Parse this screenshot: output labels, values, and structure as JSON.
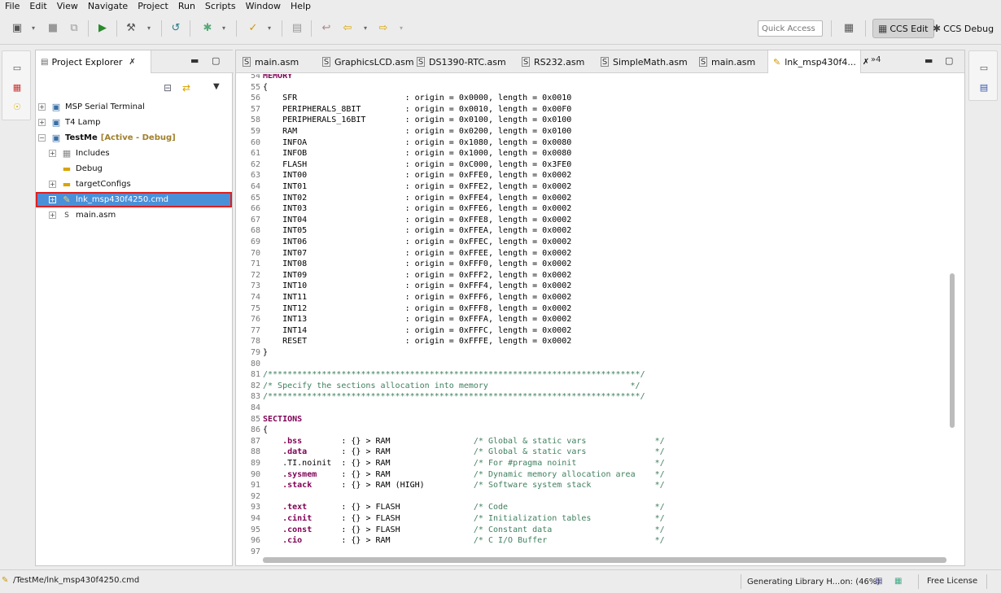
{
  "menu": [
    "File",
    "Edit",
    "View",
    "Navigate",
    "Project",
    "Run",
    "Scripts",
    "Window",
    "Help"
  ],
  "toolbar": {
    "quick_access_placeholder": "Quick Access",
    "perspectives": [
      {
        "label": "CCS Edit",
        "active": true
      },
      {
        "label": "CCS Debug",
        "active": false
      }
    ]
  },
  "explorer": {
    "title": "Project Explorer",
    "items": [
      {
        "label": "MSP Serial Terminal",
        "decoration": ""
      },
      {
        "label": "T4 Lamp",
        "decoration": ""
      },
      {
        "label": "TestMe",
        "decoration": "[Active - Debug]"
      },
      {
        "label": "Includes",
        "decoration": ""
      },
      {
        "label": "Debug",
        "decoration": ""
      },
      {
        "label": "targetConfigs",
        "decoration": ""
      },
      {
        "label": "lnk_msp430f4250.cmd",
        "decoration": ""
      },
      {
        "label": "main.asm",
        "decoration": ""
      }
    ],
    "selected": "lnk_msp430f4250.cmd"
  },
  "editor": {
    "tabs": [
      "main.asm",
      "GraphicsLCD.asm",
      "DS1390-RTC.asm",
      "RS232.asm",
      "SimpleMath.asm",
      "main.asm",
      "lnk_msp430f4..."
    ],
    "overflow": "»4",
    "lines": [
      {
        "n": "54",
        "t": "MEMORY",
        "k": "kw"
      },
      {
        "n": "55",
        "t": "{",
        "k": ""
      },
      {
        "n": "56",
        "t": "    SFR                      : origin = 0x0000, length = 0x0010",
        "k": ""
      },
      {
        "n": "57",
        "t": "    PERIPHERALS_8BIT         : origin = 0x0010, length = 0x00F0",
        "k": ""
      },
      {
        "n": "58",
        "t": "    PERIPHERALS_16BIT        : origin = 0x0100, length = 0x0100",
        "k": ""
      },
      {
        "n": "59",
        "t": "    RAM                      : origin = 0x0200, length = 0x0100",
        "k": ""
      },
      {
        "n": "60",
        "t": "    INFOA                    : origin = 0x1080, length = 0x0080",
        "k": ""
      },
      {
        "n": "61",
        "t": "    INFOB                    : origin = 0x1000, length = 0x0080",
        "k": ""
      },
      {
        "n": "62",
        "t": "    FLASH                    : origin = 0xC000, length = 0x3FE0",
        "k": ""
      },
      {
        "n": "63",
        "t": "    INT00                    : origin = 0xFFE0, length = 0x0002",
        "k": ""
      },
      {
        "n": "64",
        "t": "    INT01                    : origin = 0xFFE2, length = 0x0002",
        "k": ""
      },
      {
        "n": "65",
        "t": "    INT02                    : origin = 0xFFE4, length = 0x0002",
        "k": ""
      },
      {
        "n": "66",
        "t": "    INT03                    : origin = 0xFFE6, length = 0x0002",
        "k": ""
      },
      {
        "n": "67",
        "t": "    INT04                    : origin = 0xFFE8, length = 0x0002",
        "k": ""
      },
      {
        "n": "68",
        "t": "    INT05                    : origin = 0xFFEA, length = 0x0002",
        "k": ""
      },
      {
        "n": "69",
        "t": "    INT06                    : origin = 0xFFEC, length = 0x0002",
        "k": ""
      },
      {
        "n": "70",
        "t": "    INT07                    : origin = 0xFFEE, length = 0x0002",
        "k": ""
      },
      {
        "n": "71",
        "t": "    INT08                    : origin = 0xFFF0, length = 0x0002",
        "k": ""
      },
      {
        "n": "72",
        "t": "    INT09                    : origin = 0xFFF2, length = 0x0002",
        "k": ""
      },
      {
        "n": "73",
        "t": "    INT10                    : origin = 0xFFF4, length = 0x0002",
        "k": ""
      },
      {
        "n": "74",
        "t": "    INT11                    : origin = 0xFFF6, length = 0x0002",
        "k": ""
      },
      {
        "n": "75",
        "t": "    INT12                    : origin = 0xFFF8, length = 0x0002",
        "k": ""
      },
      {
        "n": "76",
        "t": "    INT13                    : origin = 0xFFFA, length = 0x0002",
        "k": ""
      },
      {
        "n": "77",
        "t": "    INT14                    : origin = 0xFFFC, length = 0x0002",
        "k": ""
      },
      {
        "n": "78",
        "t": "    RESET                    : origin = 0xFFFE, length = 0x0002",
        "k": ""
      },
      {
        "n": "79",
        "t": "}",
        "k": ""
      },
      {
        "n": "80",
        "t": "",
        "k": ""
      },
      {
        "n": "81",
        "t": "/****************************************************************************/",
        "k": "cm"
      },
      {
        "n": "82",
        "t": "/* Specify the sections allocation into memory                             */",
        "k": "cm"
      },
      {
        "n": "83",
        "t": "/****************************************************************************/",
        "k": "cm"
      },
      {
        "n": "84",
        "t": "",
        "k": ""
      },
      {
        "n": "85",
        "t": "SECTIONS",
        "k": "kw"
      },
      {
        "n": "86",
        "t": "{",
        "k": ""
      },
      {
        "n": "87",
        "t": "    .bss        : {} > RAM                 /* Global & static vars              */",
        "k": "sec",
        "kwpart": ".bss"
      },
      {
        "n": "88",
        "t": "    .data       : {} > RAM                 /* Global & static vars              */",
        "k": "sec",
        "kwpart": ".data"
      },
      {
        "n": "89",
        "t": "    .TI.noinit  : {} > RAM                 /* For #pragma noinit                */",
        "k": "sec",
        "kwpart": ""
      },
      {
        "n": "90",
        "t": "    .sysmem     : {} > RAM                 /* Dynamic memory allocation area    */",
        "k": "sec",
        "kwpart": ".sysmem"
      },
      {
        "n": "91",
        "t": "    .stack      : {} > RAM (HIGH)          /* Software system stack             */",
        "k": "sec",
        "kwpart": ".stack"
      },
      {
        "n": "92",
        "t": "",
        "k": ""
      },
      {
        "n": "93",
        "t": "    .text       : {} > FLASH               /* Code                              */",
        "k": "sec",
        "kwpart": ".text"
      },
      {
        "n": "94",
        "t": "    .cinit      : {} > FLASH               /* Initialization tables             */",
        "k": "sec",
        "kwpart": ".cinit"
      },
      {
        "n": "95",
        "t": "    .const      : {} > FLASH               /* Constant data                     */",
        "k": "sec",
        "kwpart": ".const"
      },
      {
        "n": "96",
        "t": "    .cio        : {} > RAM                 /* C I/O Buffer                      */",
        "k": "sec",
        "kwpart": ".cio"
      },
      {
        "n": "97",
        "t": "",
        "k": ""
      }
    ]
  },
  "status": {
    "path": "/TestMe/lnk_msp430f4250.cmd",
    "progress_text": "Generating Library H...on: (46%)",
    "license": "Free License"
  }
}
